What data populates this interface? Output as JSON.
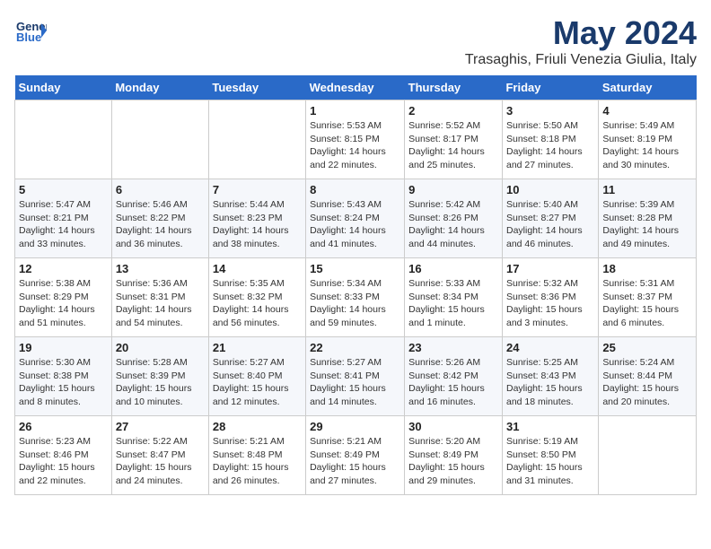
{
  "header": {
    "logo_line1": "General",
    "logo_line2": "Blue",
    "month_title": "May 2024",
    "location": "Trasaghis, Friuli Venezia Giulia, Italy"
  },
  "weekdays": [
    "Sunday",
    "Monday",
    "Tuesday",
    "Wednesday",
    "Thursday",
    "Friday",
    "Saturday"
  ],
  "weeks": [
    [
      {
        "day": "",
        "info": ""
      },
      {
        "day": "",
        "info": ""
      },
      {
        "day": "",
        "info": ""
      },
      {
        "day": "1",
        "info": "Sunrise: 5:53 AM\nSunset: 8:15 PM\nDaylight: 14 hours\nand 22 minutes."
      },
      {
        "day": "2",
        "info": "Sunrise: 5:52 AM\nSunset: 8:17 PM\nDaylight: 14 hours\nand 25 minutes."
      },
      {
        "day": "3",
        "info": "Sunrise: 5:50 AM\nSunset: 8:18 PM\nDaylight: 14 hours\nand 27 minutes."
      },
      {
        "day": "4",
        "info": "Sunrise: 5:49 AM\nSunset: 8:19 PM\nDaylight: 14 hours\nand 30 minutes."
      }
    ],
    [
      {
        "day": "5",
        "info": "Sunrise: 5:47 AM\nSunset: 8:21 PM\nDaylight: 14 hours\nand 33 minutes."
      },
      {
        "day": "6",
        "info": "Sunrise: 5:46 AM\nSunset: 8:22 PM\nDaylight: 14 hours\nand 36 minutes."
      },
      {
        "day": "7",
        "info": "Sunrise: 5:44 AM\nSunset: 8:23 PM\nDaylight: 14 hours\nand 38 minutes."
      },
      {
        "day": "8",
        "info": "Sunrise: 5:43 AM\nSunset: 8:24 PM\nDaylight: 14 hours\nand 41 minutes."
      },
      {
        "day": "9",
        "info": "Sunrise: 5:42 AM\nSunset: 8:26 PM\nDaylight: 14 hours\nand 44 minutes."
      },
      {
        "day": "10",
        "info": "Sunrise: 5:40 AM\nSunset: 8:27 PM\nDaylight: 14 hours\nand 46 minutes."
      },
      {
        "day": "11",
        "info": "Sunrise: 5:39 AM\nSunset: 8:28 PM\nDaylight: 14 hours\nand 49 minutes."
      }
    ],
    [
      {
        "day": "12",
        "info": "Sunrise: 5:38 AM\nSunset: 8:29 PM\nDaylight: 14 hours\nand 51 minutes."
      },
      {
        "day": "13",
        "info": "Sunrise: 5:36 AM\nSunset: 8:31 PM\nDaylight: 14 hours\nand 54 minutes."
      },
      {
        "day": "14",
        "info": "Sunrise: 5:35 AM\nSunset: 8:32 PM\nDaylight: 14 hours\nand 56 minutes."
      },
      {
        "day": "15",
        "info": "Sunrise: 5:34 AM\nSunset: 8:33 PM\nDaylight: 14 hours\nand 59 minutes."
      },
      {
        "day": "16",
        "info": "Sunrise: 5:33 AM\nSunset: 8:34 PM\nDaylight: 15 hours\nand 1 minute."
      },
      {
        "day": "17",
        "info": "Sunrise: 5:32 AM\nSunset: 8:36 PM\nDaylight: 15 hours\nand 3 minutes."
      },
      {
        "day": "18",
        "info": "Sunrise: 5:31 AM\nSunset: 8:37 PM\nDaylight: 15 hours\nand 6 minutes."
      }
    ],
    [
      {
        "day": "19",
        "info": "Sunrise: 5:30 AM\nSunset: 8:38 PM\nDaylight: 15 hours\nand 8 minutes."
      },
      {
        "day": "20",
        "info": "Sunrise: 5:28 AM\nSunset: 8:39 PM\nDaylight: 15 hours\nand 10 minutes."
      },
      {
        "day": "21",
        "info": "Sunrise: 5:27 AM\nSunset: 8:40 PM\nDaylight: 15 hours\nand 12 minutes."
      },
      {
        "day": "22",
        "info": "Sunrise: 5:27 AM\nSunset: 8:41 PM\nDaylight: 15 hours\nand 14 minutes."
      },
      {
        "day": "23",
        "info": "Sunrise: 5:26 AM\nSunset: 8:42 PM\nDaylight: 15 hours\nand 16 minutes."
      },
      {
        "day": "24",
        "info": "Sunrise: 5:25 AM\nSunset: 8:43 PM\nDaylight: 15 hours\nand 18 minutes."
      },
      {
        "day": "25",
        "info": "Sunrise: 5:24 AM\nSunset: 8:44 PM\nDaylight: 15 hours\nand 20 minutes."
      }
    ],
    [
      {
        "day": "26",
        "info": "Sunrise: 5:23 AM\nSunset: 8:46 PM\nDaylight: 15 hours\nand 22 minutes."
      },
      {
        "day": "27",
        "info": "Sunrise: 5:22 AM\nSunset: 8:47 PM\nDaylight: 15 hours\nand 24 minutes."
      },
      {
        "day": "28",
        "info": "Sunrise: 5:21 AM\nSunset: 8:48 PM\nDaylight: 15 hours\nand 26 minutes."
      },
      {
        "day": "29",
        "info": "Sunrise: 5:21 AM\nSunset: 8:49 PM\nDaylight: 15 hours\nand 27 minutes."
      },
      {
        "day": "30",
        "info": "Sunrise: 5:20 AM\nSunset: 8:49 PM\nDaylight: 15 hours\nand 29 minutes."
      },
      {
        "day": "31",
        "info": "Sunrise: 5:19 AM\nSunset: 8:50 PM\nDaylight: 15 hours\nand 31 minutes."
      },
      {
        "day": "",
        "info": ""
      }
    ]
  ]
}
